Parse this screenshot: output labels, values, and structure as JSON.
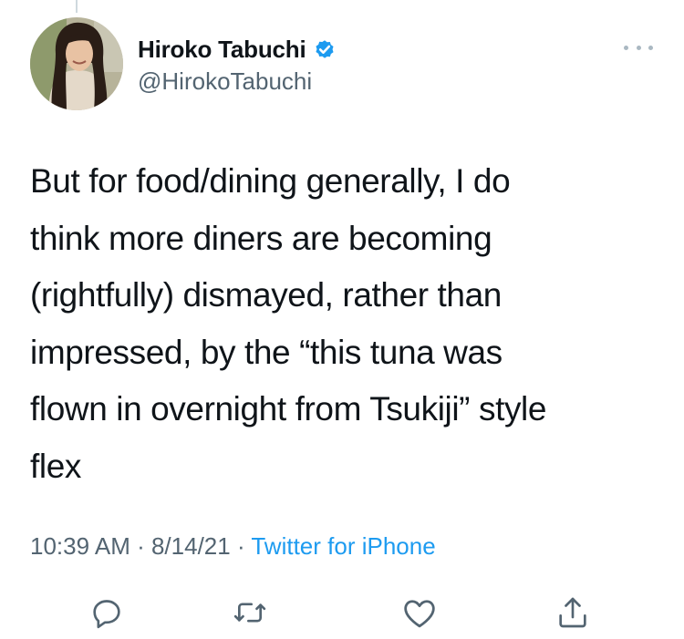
{
  "author": {
    "display_name": "Hiroko Tabuchi",
    "handle": "@HirokoTabuchi",
    "verified_icon": "verified-badge-icon",
    "avatar": "profile-photo"
  },
  "tweet": {
    "lines": [
      "But for food/dining generally, I do",
      "think more diners are becoming",
      "(rightfully) dismayed, rather than",
      "impressed, by the “this tuna was",
      "flown in overnight from Tsukiji” style",
      "flex"
    ]
  },
  "meta": {
    "time": "10:39 AM",
    "sep1": " · ",
    "date": "8/14/21",
    "sep2": " · ",
    "source": "Twitter for iPhone"
  },
  "actions": {
    "reply_icon": "reply-icon",
    "retweet_icon": "retweet-icon",
    "like_icon": "heart-icon",
    "share_icon": "share-icon"
  },
  "colors": {
    "text": "#0f1419",
    "secondary": "#536471",
    "accent": "#1d9bf0",
    "verified": "#1d9bf0"
  }
}
